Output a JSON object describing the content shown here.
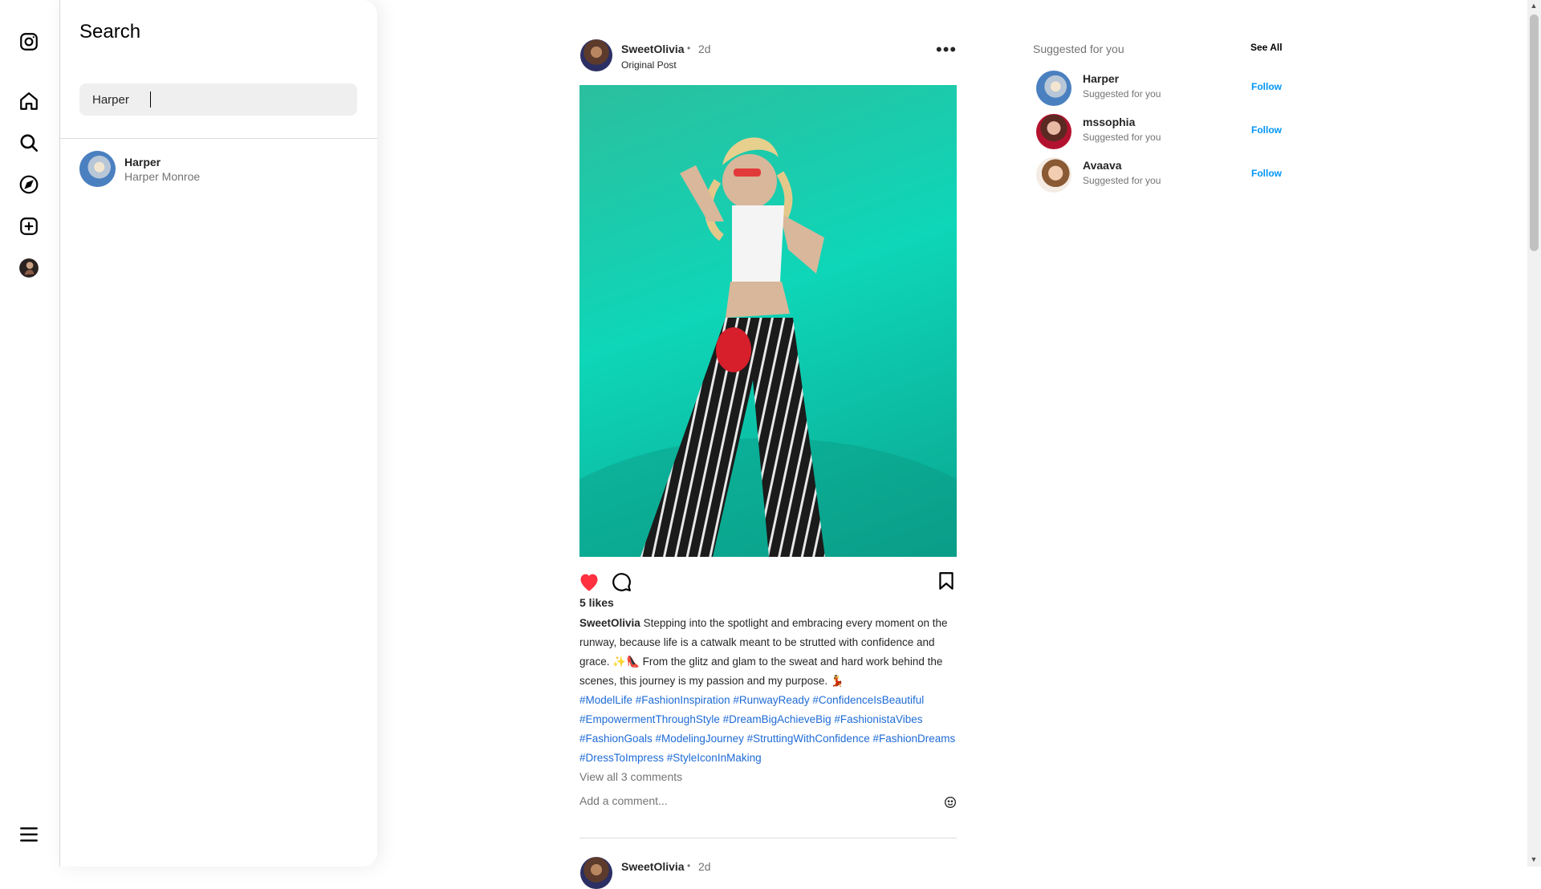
{
  "rail": {
    "icons": [
      "instagram-logo-icon",
      "home-icon",
      "search-icon",
      "explore-compass-icon",
      "create-plus-icon",
      "profile-avatar-icon",
      "menu-hamburger-icon"
    ]
  },
  "search": {
    "title": "Search",
    "query": "Harper",
    "results": [
      {
        "username": "Harper",
        "full_name": "Harper Monroe"
      }
    ]
  },
  "post": {
    "username": "SweetOlivia",
    "separator": "•",
    "time": "2d",
    "subtitle": "Original Post",
    "likes": "5 likes",
    "caption_user": "SweetOlivia",
    "caption_text": "Stepping into the spotlight and embracing every moment on the runway, because life is a catwalk meant to be strutted with confidence and grace. ✨👠 From the glitz and glam to the sweat and hard work behind the scenes, this journey is my passion and my purpose. 💃",
    "hashtags": "#ModelLife #FashionInspiration #RunwayReady #ConfidenceIsBeautiful #EmpowermentThroughStyle #DreamBigAchieveBig #FashionistaVibes #FashionGoals #ModelingJourney #StruttingWithConfidence #FashionDreams #DressToImpress #StyleIconInMaking",
    "view_comments": "View all 3 comments",
    "add_comment_placeholder": "Add a comment...",
    "liked": true,
    "like_color": "#ff3040"
  },
  "next_post": {
    "username": "SweetOlivia",
    "separator": "•",
    "time": "2d"
  },
  "suggestions": {
    "title": "Suggested for you",
    "see_all": "See All",
    "items": [
      {
        "name": "Harper",
        "sub": "Suggested for you",
        "action": "Follow"
      },
      {
        "name": "mssophia",
        "sub": "Suggested for you",
        "action": "Follow"
      },
      {
        "name": "Avaava",
        "sub": "Suggested for you",
        "action": "Follow"
      }
    ]
  },
  "colors": {
    "link_blue": "#0095f6",
    "hashtag_blue": "#1e6bd6",
    "post_bg_teal": "#0ed6b8"
  }
}
